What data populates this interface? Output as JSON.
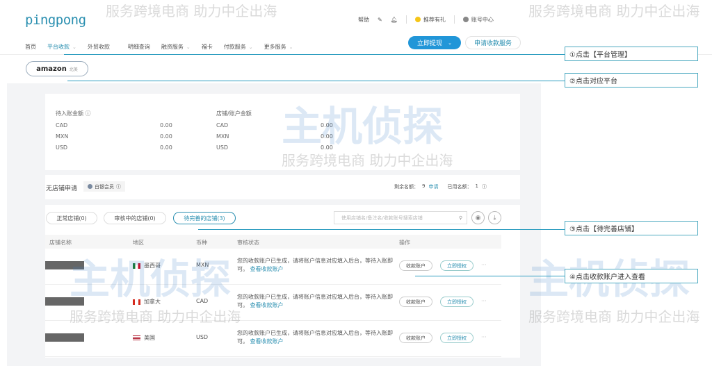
{
  "header": {
    "logo": "pingpong",
    "help": "帮助",
    "referral": "推荐有礼",
    "account": "账号中心",
    "nav": [
      {
        "label": "首页"
      },
      {
        "label": "平台收款",
        "active": true,
        "dropdown": true
      },
      {
        "label": "外贸收款"
      },
      {
        "label": "明细查询"
      },
      {
        "label": "融资服务",
        "dropdown": true
      },
      {
        "label": "福卡"
      },
      {
        "label": "付款服务",
        "dropdown": true
      },
      {
        "label": "更多服务",
        "dropdown": true
      }
    ],
    "withdraw_btn": "立即提现",
    "apply_btn": "申请收款服务"
  },
  "platform": {
    "name": "amazon",
    "region": "北美"
  },
  "balances": {
    "pending_title": "待入账金额",
    "store_title": "店铺/账户金额",
    "rows": [
      {
        "cur": "CAD",
        "pending": "0.00",
        "store": "0.00"
      },
      {
        "cur": "MXN",
        "pending": "0.00",
        "store": "0.00"
      },
      {
        "cur": "USD",
        "pending": "0.00",
        "store": "0.00"
      }
    ]
  },
  "store_apply": {
    "title": "无店铺申请",
    "member": "白银会员",
    "remaining_label": "剩余名额：",
    "remaining": "9",
    "apply": "申请",
    "used_label": "已用名额：",
    "used": "1"
  },
  "tabs": [
    {
      "label": "正常店铺(0)"
    },
    {
      "label": "审核中的店铺(0)"
    },
    {
      "label": "待完善的店铺(3)",
      "selected": true
    }
  ],
  "search_placeholder": "使用店铺名/备注名/收款账号搜索店铺",
  "table": {
    "headers": [
      "店铺名称",
      "地区",
      "币种",
      "审核状态",
      "操作"
    ],
    "rows": [
      {
        "region": "墨西哥",
        "flag": "mx",
        "currency": "MXN",
        "status": "您的收款账户已生成，请将账户信息对应填入后台，等待入账即可。",
        "link": "查看收款账户",
        "btn1": "收款账户",
        "btn2": "立即授权",
        "more": "···"
      },
      {
        "region": "加拿大",
        "flag": "ca",
        "currency": "CAD",
        "status": "您的收款账户已生成，请将账户信息对应填入后台，等待入账即可。",
        "link": "查看收款账户",
        "btn1": "收款账户",
        "btn2": "立即授权",
        "more": "···"
      },
      {
        "region": "美国",
        "flag": "us",
        "currency": "USD",
        "status": "您的收款账户已生成，请将账户信息对应填入后台，等待入账即可。",
        "link": "查看收款账户",
        "btn1": "收款账户",
        "btn2": "立即授权",
        "more": "···"
      }
    ]
  },
  "annotations": [
    "①点击【平台管理】",
    "②点击对应平台",
    "③点击【待完善店铺】",
    "④点击收款账户进入查看"
  ],
  "watermark": {
    "slogan": "服务跨境电商 助力中企出海",
    "brand": "主机侦探"
  },
  "colors": {
    "accent": "#2196d8",
    "link": "#2a8fb0",
    "annotation_line": "#2a9cbf"
  }
}
